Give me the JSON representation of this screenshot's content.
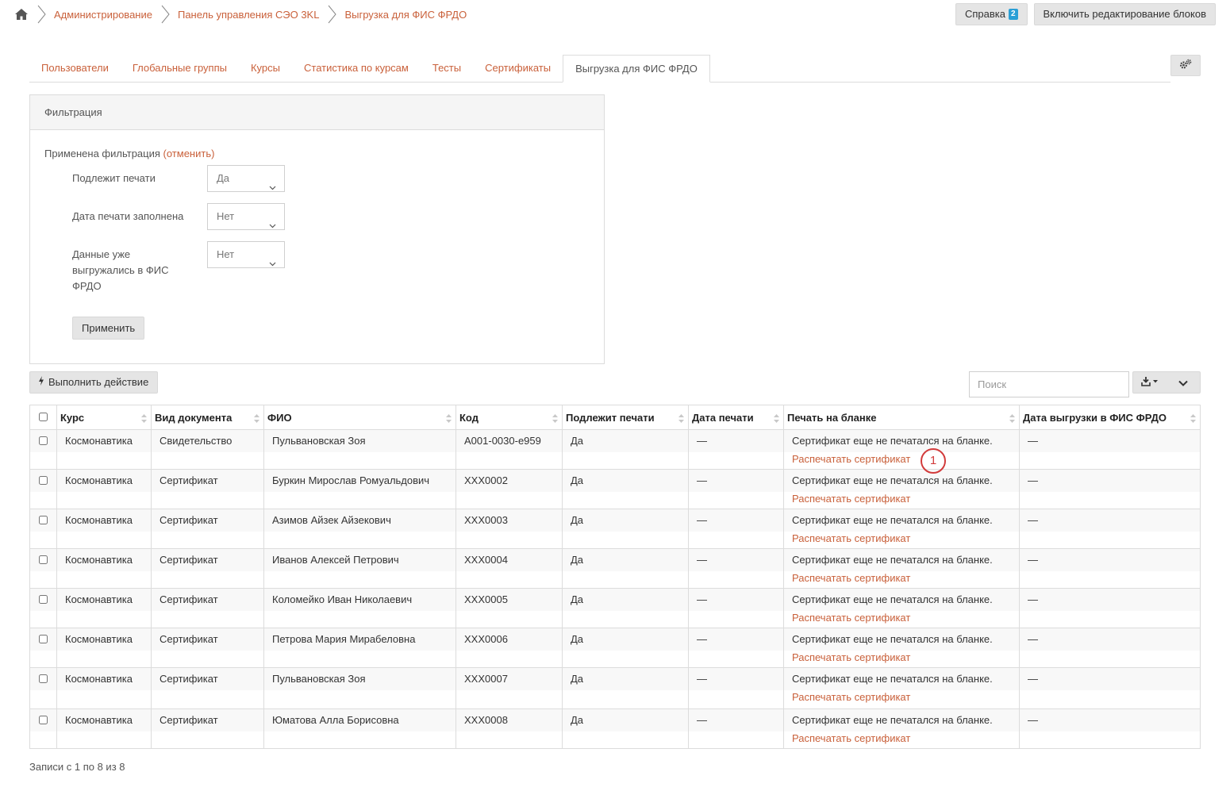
{
  "breadcrumb": {
    "home_icon": "home-icon",
    "items": [
      "Администрирование",
      "Панель управления СЭО 3KL",
      "Выгрузка для ФИС ФРДО"
    ]
  },
  "header": {
    "help_label": "Справка",
    "help_badge": "2",
    "edit_blocks_label": "Включить редактирование блоков"
  },
  "tabs": [
    {
      "label": "Пользователи",
      "active": false
    },
    {
      "label": "Глобальные группы",
      "active": false
    },
    {
      "label": "Курсы",
      "active": false
    },
    {
      "label": "Статистика по курсам",
      "active": false
    },
    {
      "label": "Тесты",
      "active": false
    },
    {
      "label": "Сертификаты",
      "active": false
    },
    {
      "label": "Выгрузка для ФИС ФРДО",
      "active": true
    }
  ],
  "filter": {
    "title": "Фильтрация",
    "applied_text": "Применена фильтрация",
    "cancel_link": "(отменить)",
    "fields": [
      {
        "label": "Подлежит печати",
        "value": "Да"
      },
      {
        "label": "Дата печати заполнена",
        "value": "Нет"
      },
      {
        "label": "Данные уже выгружались в ФИС ФРДО",
        "value": "Нет"
      }
    ],
    "apply_label": "Применить"
  },
  "actions": {
    "execute_label": "Выполнить действие",
    "search_placeholder": "Поиск"
  },
  "table": {
    "columns": [
      "Курс",
      "Вид документа",
      "ФИО",
      "Код",
      "Подлежит печати",
      "Дата печати",
      "Печать на бланке",
      "Дата выгрузки в ФИС ФРДО"
    ],
    "rows": [
      {
        "course": "Космонавтика",
        "doc": "Свидетельство",
        "name": "Пульвановская Зоя",
        "code": "А001-0030-е959",
        "print": "Да",
        "date": "—",
        "status": "Сертификат еще не печатался на бланке.",
        "link": "Распечатать сертификат",
        "export": "—"
      },
      {
        "course": "Космонавтика",
        "doc": "Сертификат",
        "name": "Буркин Мирослав Ромуальдович",
        "code": "ХХХ0002",
        "print": "Да",
        "date": "—",
        "status": "Сертификат еще не печатался на бланке.",
        "link": "Распечатать сертификат",
        "export": "—"
      },
      {
        "course": "Космонавтика",
        "doc": "Сертификат",
        "name": "Азимов Айзек Айзекович",
        "code": "ХХХ0003",
        "print": "Да",
        "date": "—",
        "status": "Сертификат еще не печатался на бланке.",
        "link": "Распечатать сертификат",
        "export": "—"
      },
      {
        "course": "Космонавтика",
        "doc": "Сертификат",
        "name": "Иванов Алексей Петрович",
        "code": "ХХХ0004",
        "print": "Да",
        "date": "—",
        "status": "Сертификат еще не печатался на бланке.",
        "link": "Распечатать сертификат",
        "export": "—"
      },
      {
        "course": "Космонавтика",
        "doc": "Сертификат",
        "name": "Коломейко Иван Николаевич",
        "code": "ХХХ0005",
        "print": "Да",
        "date": "—",
        "status": "Сертификат еще не печатался на бланке.",
        "link": "Распечатать сертификат",
        "export": "—"
      },
      {
        "course": "Космонавтика",
        "doc": "Сертификат",
        "name": "Петрова Мария Мирабеловна",
        "code": "ХХХ0006",
        "print": "Да",
        "date": "—",
        "status": "Сертификат еще не печатался на бланке.",
        "link": "Распечатать сертификат",
        "export": "—"
      },
      {
        "course": "Космонавтика",
        "doc": "Сертификат",
        "name": "Пульвановская Зоя",
        "code": "ХХХ0007",
        "print": "Да",
        "date": "—",
        "status": "Сертификат еще не печатался на бланке.",
        "link": "Распечатать сертификат",
        "export": "—"
      },
      {
        "course": "Космонавтика",
        "doc": "Сертификат",
        "name": "Юматова Алла Борисовна",
        "code": "ХХХ0008",
        "print": "Да",
        "date": "—",
        "status": "Сертификат еще не печатался на бланке.",
        "link": "Распечатать сертификат",
        "export": "—"
      }
    ]
  },
  "annotation": {
    "marker_label": "1"
  },
  "footer": {
    "records_text": "Записи с 1 по 8 из 8"
  },
  "colors": {
    "link": "#c9603a",
    "badge": "#2a9fd6",
    "marker": "#d23b3b"
  }
}
